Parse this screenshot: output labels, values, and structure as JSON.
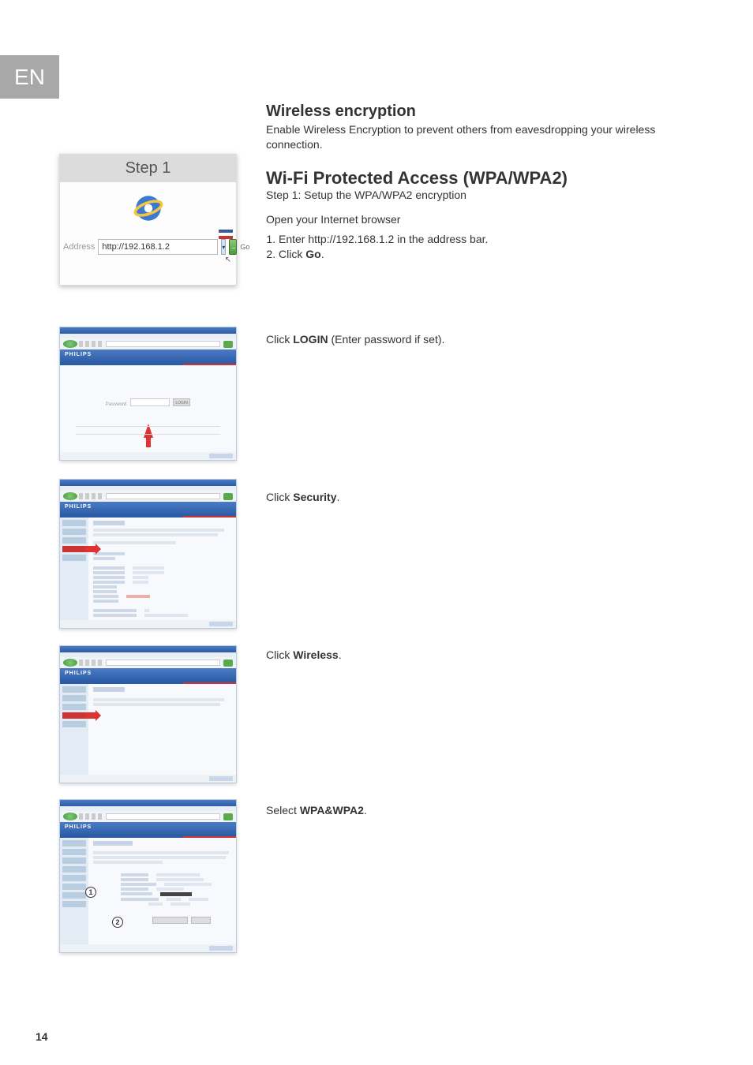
{
  "lang_tab": "EN",
  "page_number": "14",
  "header": {
    "title": "Wireless encryption",
    "desc": "Enable Wireless Encryption to prevent others from eavesdropping your wireless connection.",
    "wpa_title": "Wi-Fi Protected Access (WPA/WPA2)",
    "wpa_step": "Step 1: Setup the WPA/WPA2 encryption",
    "open_browser": "Open your Internet browser",
    "step1_item1": "Enter http://192.168.1.2 in the address bar.",
    "step2_item_pre": "Click ",
    "step2_item_bold": "Go",
    "step2_item_post": "."
  },
  "step1_card": {
    "title": "Step 1",
    "address_label": "Address",
    "address_value": "http://192.168.1.2",
    "go_label": "Go"
  },
  "instr": {
    "login_pre": "Click ",
    "login_bold": "LOGIN",
    "login_post": " (Enter password if set).",
    "security_pre": "Click ",
    "security_bold": "Security",
    "security_post": ".",
    "wireless_pre": "Click ",
    "wireless_bold": "Wireless",
    "wireless_post": ".",
    "wpa_pre": "Select ",
    "wpa_bold": "WPA&WPA2",
    "wpa_post": "."
  },
  "screenshots": {
    "brand": "PHILIPS",
    "login": {
      "password_label": "Password",
      "button": "LOGIN"
    },
    "circled_1": "1",
    "circled_2": "2"
  }
}
